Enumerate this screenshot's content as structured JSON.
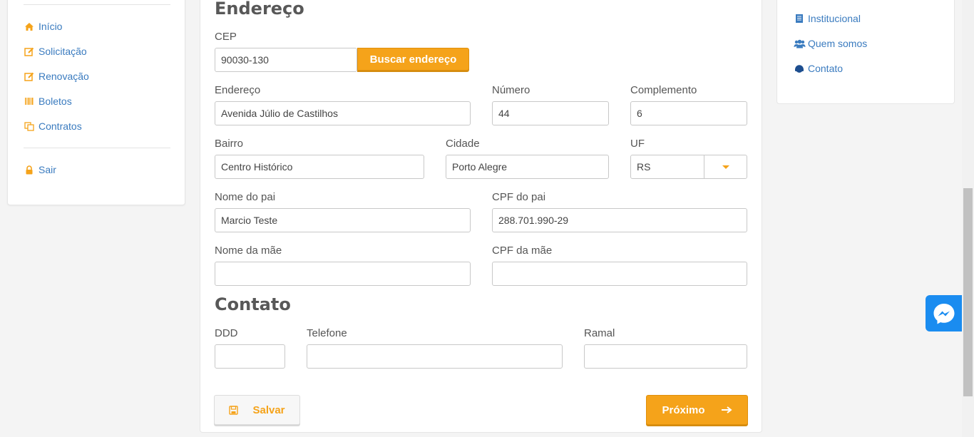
{
  "sidebar": {
    "items": [
      {
        "label": "Início",
        "icon": "home-icon"
      },
      {
        "label": "Solicitação",
        "icon": "edit-icon"
      },
      {
        "label": "Renovação",
        "icon": "edit-icon"
      },
      {
        "label": "Boletos",
        "icon": "barcode-icon"
      },
      {
        "label": "Contratos",
        "icon": "copy-icon"
      }
    ],
    "logout": {
      "label": "Sair",
      "icon": "lock-icon"
    }
  },
  "form": {
    "address_title": "Endereço",
    "cep": {
      "label": "CEP",
      "value": "90030-130"
    },
    "search_button": "Buscar endereço",
    "endereco": {
      "label": "Endereço",
      "value": "Avenida Júlio de Castilhos"
    },
    "numero": {
      "label": "Número",
      "value": "44"
    },
    "complemento": {
      "label": "Complemento",
      "value": "6"
    },
    "bairro": {
      "label": "Bairro",
      "value": "Centro Histórico"
    },
    "cidade": {
      "label": "Cidade",
      "value": "Porto Alegre"
    },
    "uf": {
      "label": "UF",
      "value": "RS"
    },
    "nome_pai": {
      "label": "Nome do pai",
      "value": "Marcio Teste"
    },
    "cpf_pai": {
      "label": "CPF do pai",
      "value": "288.701.990-29"
    },
    "nome_mae": {
      "label": "Nome da mãe",
      "value": ""
    },
    "cpf_mae": {
      "label": "CPF da mãe",
      "value": ""
    },
    "contact_title": "Contato",
    "ddd": {
      "label": "DDD",
      "value": ""
    },
    "telefone": {
      "label": "Telefone",
      "value": ""
    },
    "ramal": {
      "label": "Ramal",
      "value": ""
    },
    "save_button": "Salvar",
    "next_button": "Próximo"
  },
  "right_menu": {
    "items": [
      {
        "label": "Institucional",
        "icon": "document-icon"
      },
      {
        "label": "Quem somos",
        "icon": "users-icon"
      },
      {
        "label": "Contato",
        "icon": "headset-icon"
      }
    ]
  },
  "colors": {
    "accent": "#f5a31a",
    "link": "#3a7bbf",
    "messenger": "#1a8cf0"
  }
}
